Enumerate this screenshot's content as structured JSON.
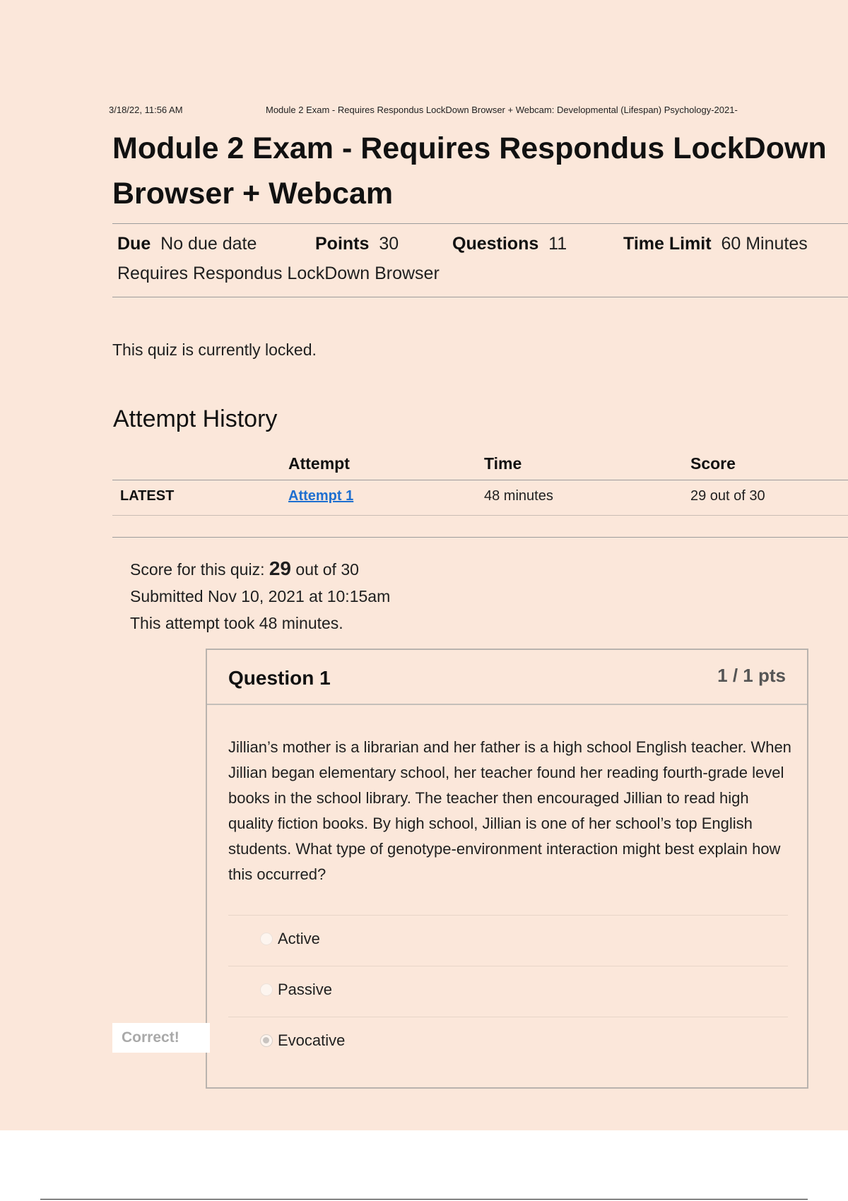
{
  "print_header": {
    "datetime": "3/18/22, 11:56 AM",
    "page_title": "Module 2 Exam - Requires Respondus LockDown Browser + Webcam: Developmental (Lifespan) Psychology-2021-"
  },
  "exam": {
    "title": "Module 2 Exam - Requires Respondus LockDown Browser + Webcam",
    "due_label": "Due",
    "due_value": "No due date",
    "points_label": "Points",
    "points_value": "30",
    "questions_label": "Questions",
    "questions_value": "11",
    "time_limit_label": "Time Limit",
    "time_limit_value": "60 Minutes",
    "requirement": "Requires Respondus LockDown Browser",
    "locked_message": "This quiz is currently locked."
  },
  "attempt_history": {
    "heading": "Attempt History",
    "columns": [
      "Attempt",
      "Time",
      "Score"
    ],
    "rows": [
      {
        "tag": "LATEST",
        "attempt": "Attempt 1",
        "time": "48 minutes",
        "score": "29 out of 30"
      }
    ]
  },
  "score_summary": {
    "prefix": "Score for this quiz:",
    "score": "29",
    "suffix": "out of 30",
    "submitted": "Submitted Nov 10, 2021 at 10:15am",
    "duration": "This attempt took 48 minutes."
  },
  "question": {
    "title": "Question 1",
    "points": "1 / 1 pts",
    "text": "Jillian’s mother is a librarian and her father is a high school English teacher. When Jillian began elementary school, her teacher found her reading fourth-grade level books in the school library. The teacher then encouraged Jillian to read high quality fiction books. By high school, Jillian is one of her school’s top English students. What type of genotype-environment interaction might best explain how this occurred?",
    "answers": [
      {
        "label": "Active",
        "selected": false
      },
      {
        "label": "Passive",
        "selected": false
      },
      {
        "label": "Evocative",
        "selected": true
      }
    ],
    "result_tag": "Correct!"
  }
}
